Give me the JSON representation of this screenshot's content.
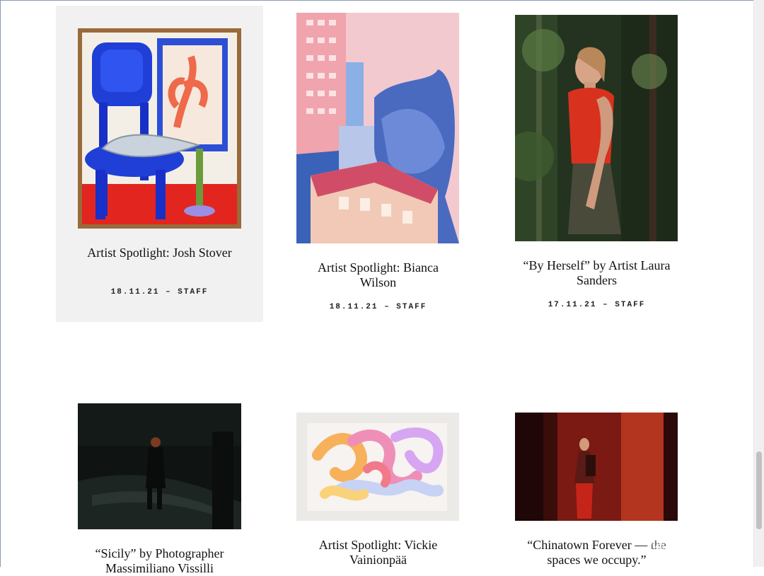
{
  "posts": [
    {
      "title": "Artist Spotlight: Josh Stover",
      "meta": "18.11.21 – STAFF",
      "image_icon": "painting-blue-chair-icon"
    },
    {
      "title": "Artist Spotlight: Bianca Wilson",
      "meta": "18.11.21 – STAFF",
      "image_icon": "painting-city-buildings-icon"
    },
    {
      "title": "“By Herself” by Artist Laura Sanders",
      "meta": "17.11.21 – STAFF",
      "image_icon": "painting-woman-forest-icon"
    },
    {
      "title": "“Sicily” by Photographer Massimiliano Vissilli",
      "meta": "",
      "image_icon": "photo-dark-silhouette-icon"
    },
    {
      "title": "Artist Spotlight: Vickie Vainionpää",
      "meta": "",
      "image_icon": "painting-abstract-tubes-icon"
    },
    {
      "title": "“Chinatown Forever — the spaces we occupy.”",
      "meta": "",
      "image_icon": "photo-red-room-woman-icon"
    }
  ],
  "watermark": {
    "text": "什么值得买",
    "icon": "zhi-icon",
    "icon_glyph": "值"
  },
  "colors": {
    "card_hover_bg": "#f1f1f1",
    "frame": "#8a9bb0"
  }
}
